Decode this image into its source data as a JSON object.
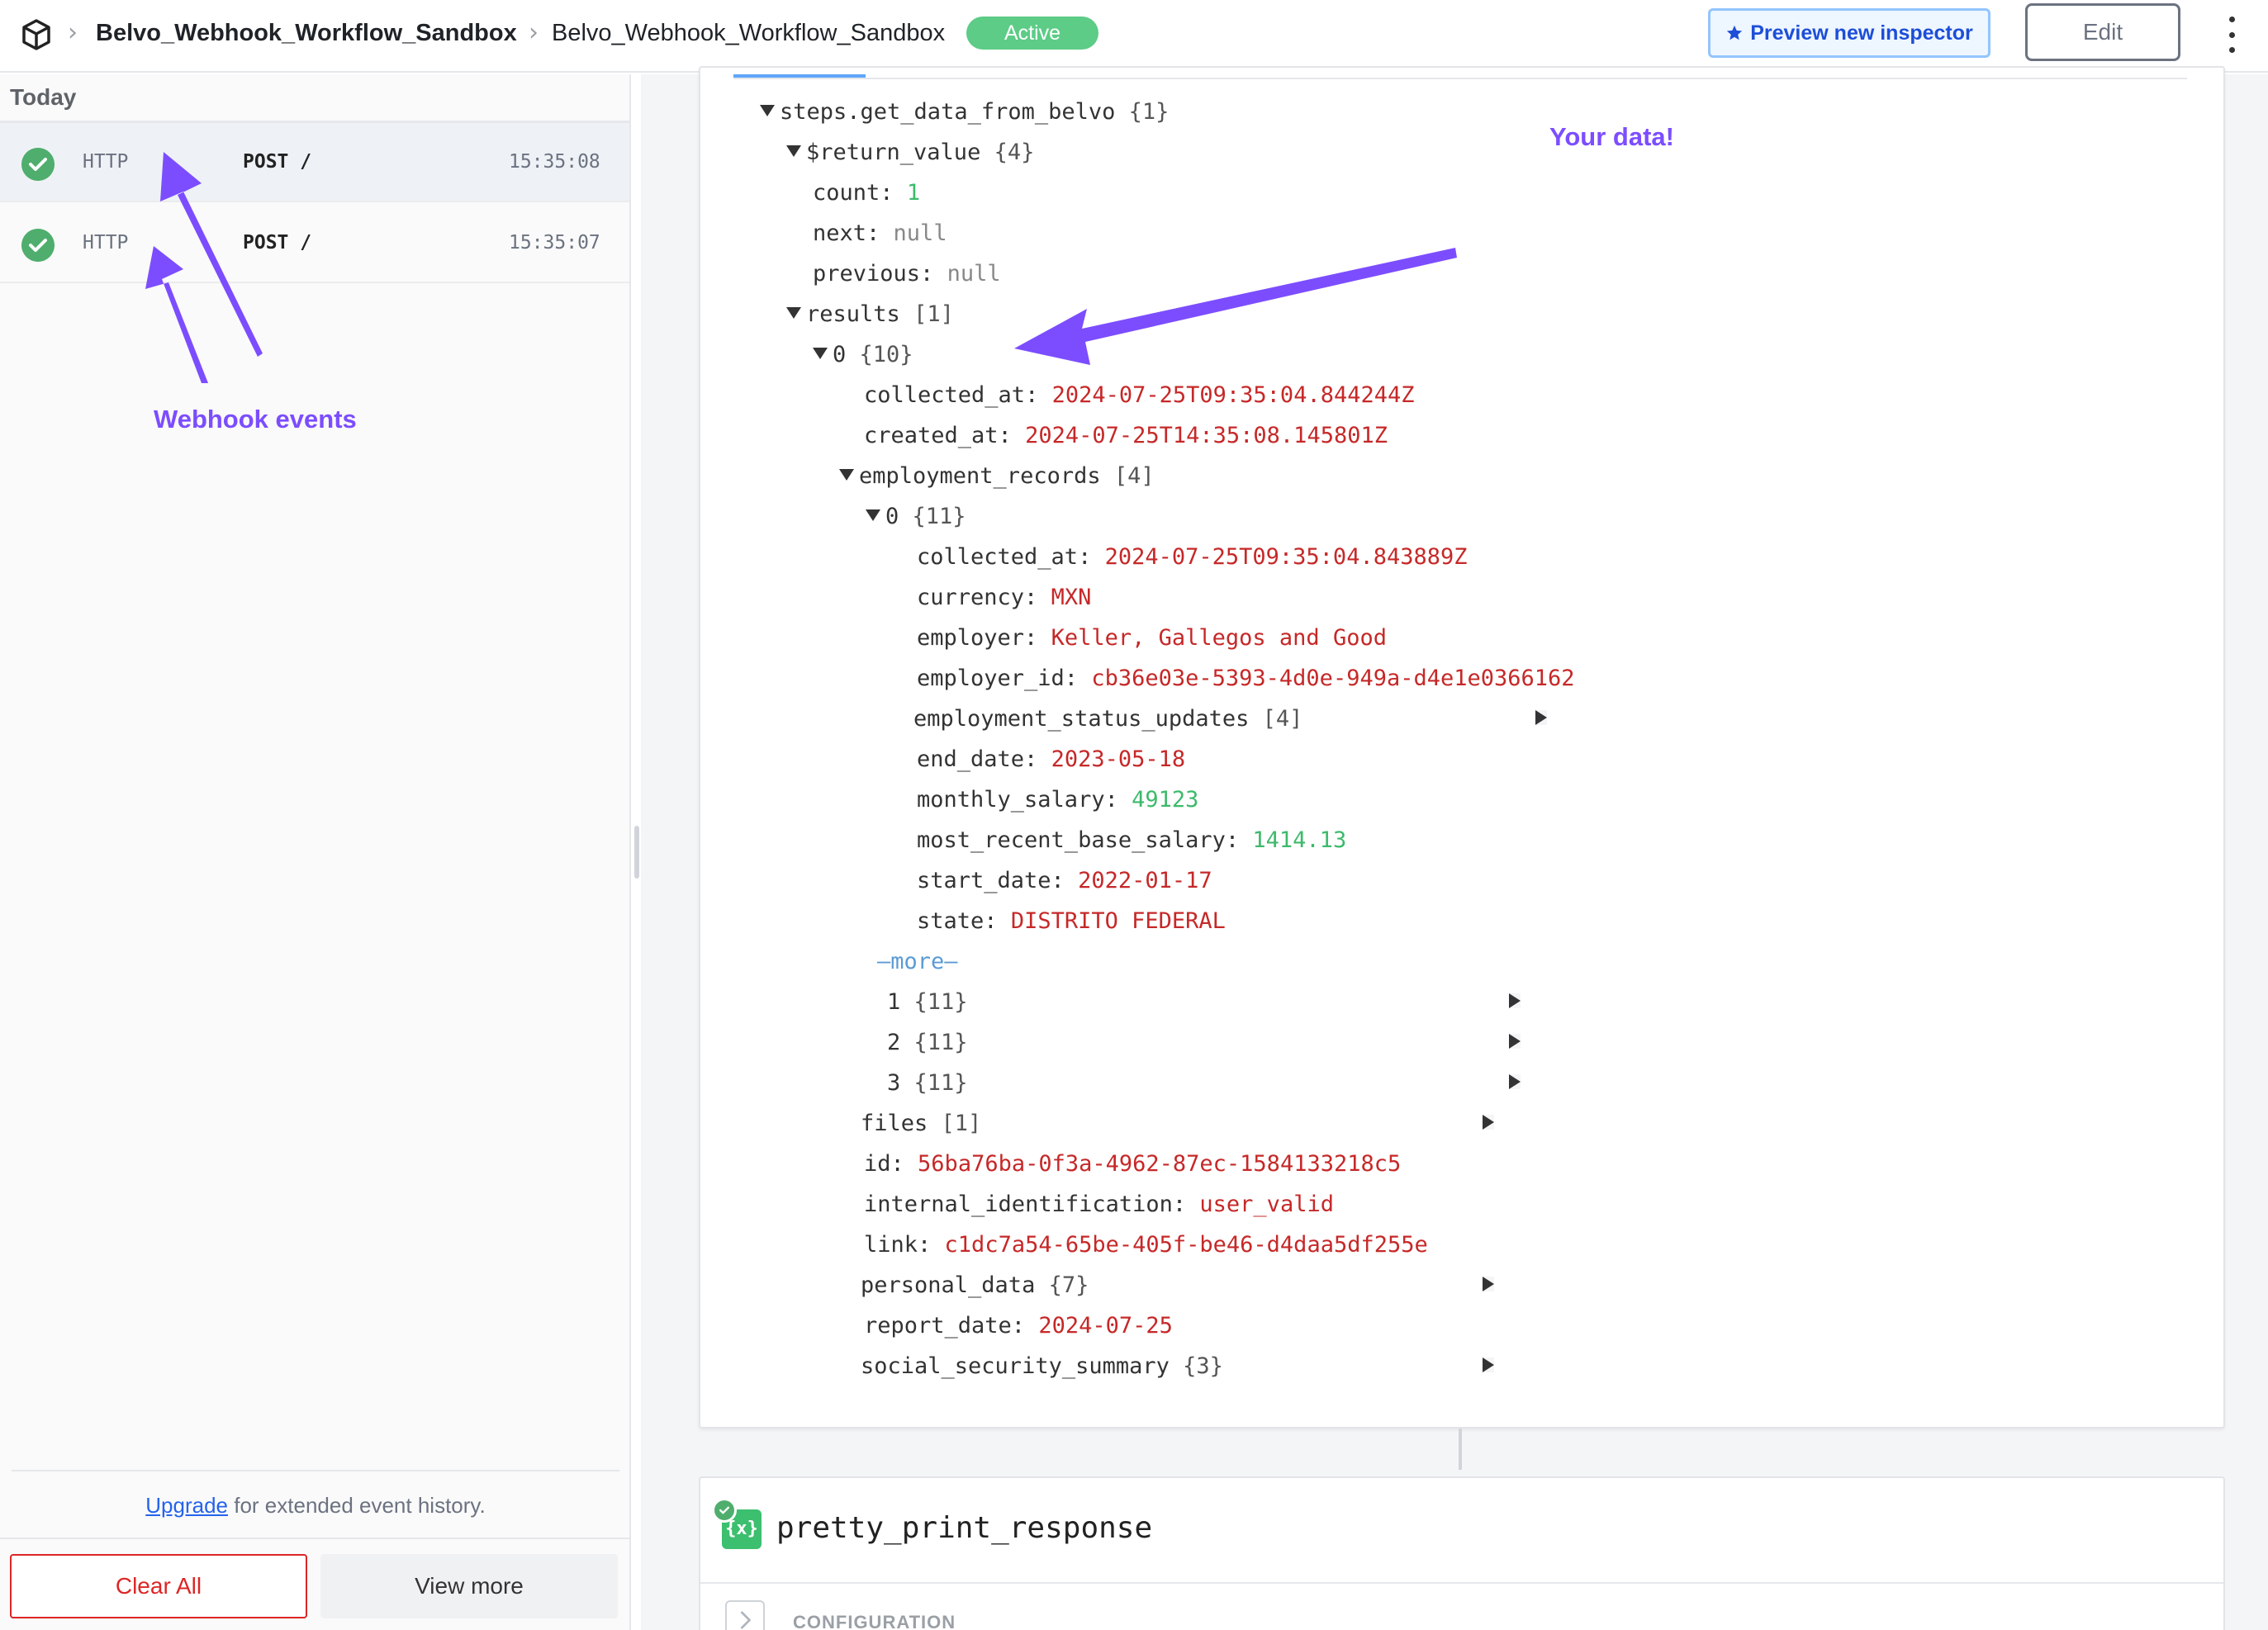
{
  "header": {
    "workflow_name": "Belvo_Webhook_Workflow_Sandbox",
    "breadcrumb_current": "Belvo_Webhook_Workflow_Sandbox",
    "status_badge": "Active",
    "preview_button": "Preview new inspector",
    "edit_button": "Edit"
  },
  "sidebar": {
    "section_label": "Today",
    "events": [
      {
        "type": "HTTP",
        "method": "POST /",
        "time": "15:35:08"
      },
      {
        "type": "HTTP",
        "method": "POST /",
        "time": "15:35:07"
      }
    ],
    "upgrade_link": "Upgrade",
    "upgrade_text": " for extended event history.",
    "clear_all": "Clear All",
    "view_more": "View more"
  },
  "annotations": {
    "webhook_events": "Webhook events",
    "your_data": "Your data!"
  },
  "tree": {
    "root_key": "steps.get_data_from_belvo",
    "root_meta": "{1}",
    "return_key": "$return_value",
    "return_meta": "{4}",
    "count_key": "count:",
    "count_val": "1",
    "next_key": "next:",
    "next_val": "null",
    "previous_key": "previous:",
    "previous_val": "null",
    "results_key": "results",
    "results_meta": "[1]",
    "r0_key": "0",
    "r0_meta": "{10}",
    "collected_at_key": "collected_at:",
    "collected_at_val": "2024-07-25T09:35:04.844244Z",
    "created_at_key": "created_at:",
    "created_at_val": "2024-07-25T14:35:08.145801Z",
    "emp_key": "employment_records",
    "emp_meta": "[4]",
    "e0_key": "0",
    "e0_meta": "{11}",
    "e_collected_key": "collected_at:",
    "e_collected_val": "2024-07-25T09:35:04.843889Z",
    "currency_key": "currency:",
    "currency_val": "MXN",
    "employer_key": "employer:",
    "employer_val": "Keller, Gallegos and Good",
    "employer_id_key": "employer_id:",
    "employer_id_val": "cb36e03e-5393-4d0e-949a-d4e1e0366162",
    "status_updates_key": "employment_status_updates",
    "status_updates_meta": "[4]",
    "end_date_key": "end_date:",
    "end_date_val": "2023-05-18",
    "monthly_salary_key": "monthly_salary:",
    "monthly_salary_val": "49123",
    "base_salary_key": "most_recent_base_salary:",
    "base_salary_val": "1414.13",
    "start_date_key": "start_date:",
    "start_date_val": "2022-01-17",
    "state_key": "state:",
    "state_val": "DISTRITO FEDERAL",
    "more": "—more—",
    "e1_key": "1",
    "e1_meta": "{11}",
    "e2_key": "2",
    "e2_meta": "{11}",
    "e3_key": "3",
    "e3_meta": "{11}",
    "files_key": "files",
    "files_meta": "[1]",
    "id_key": "id:",
    "id_val": "56ba76ba-0f3a-4962-87ec-1584133218c5",
    "internal_key": "internal_identification:",
    "internal_val": "user_valid",
    "link_key": "link:",
    "link_val": "c1dc7a54-65be-405f-be46-d4daa5df255e",
    "personal_key": "personal_data",
    "personal_meta": "{7}",
    "report_date_key": "report_date:",
    "report_date_val": "2024-07-25",
    "social_key": "social_security_summary",
    "social_meta": "{3}"
  },
  "next_step": {
    "icon_text": "{x}",
    "name": "pretty_print_response",
    "section": "CONFIGURATION"
  },
  "colors": {
    "accent_purple": "#7c4dff",
    "active_green": "#5ccc86",
    "string_red": "#c62828",
    "number_green": "#3dba6b",
    "link_blue": "#2563eb"
  }
}
